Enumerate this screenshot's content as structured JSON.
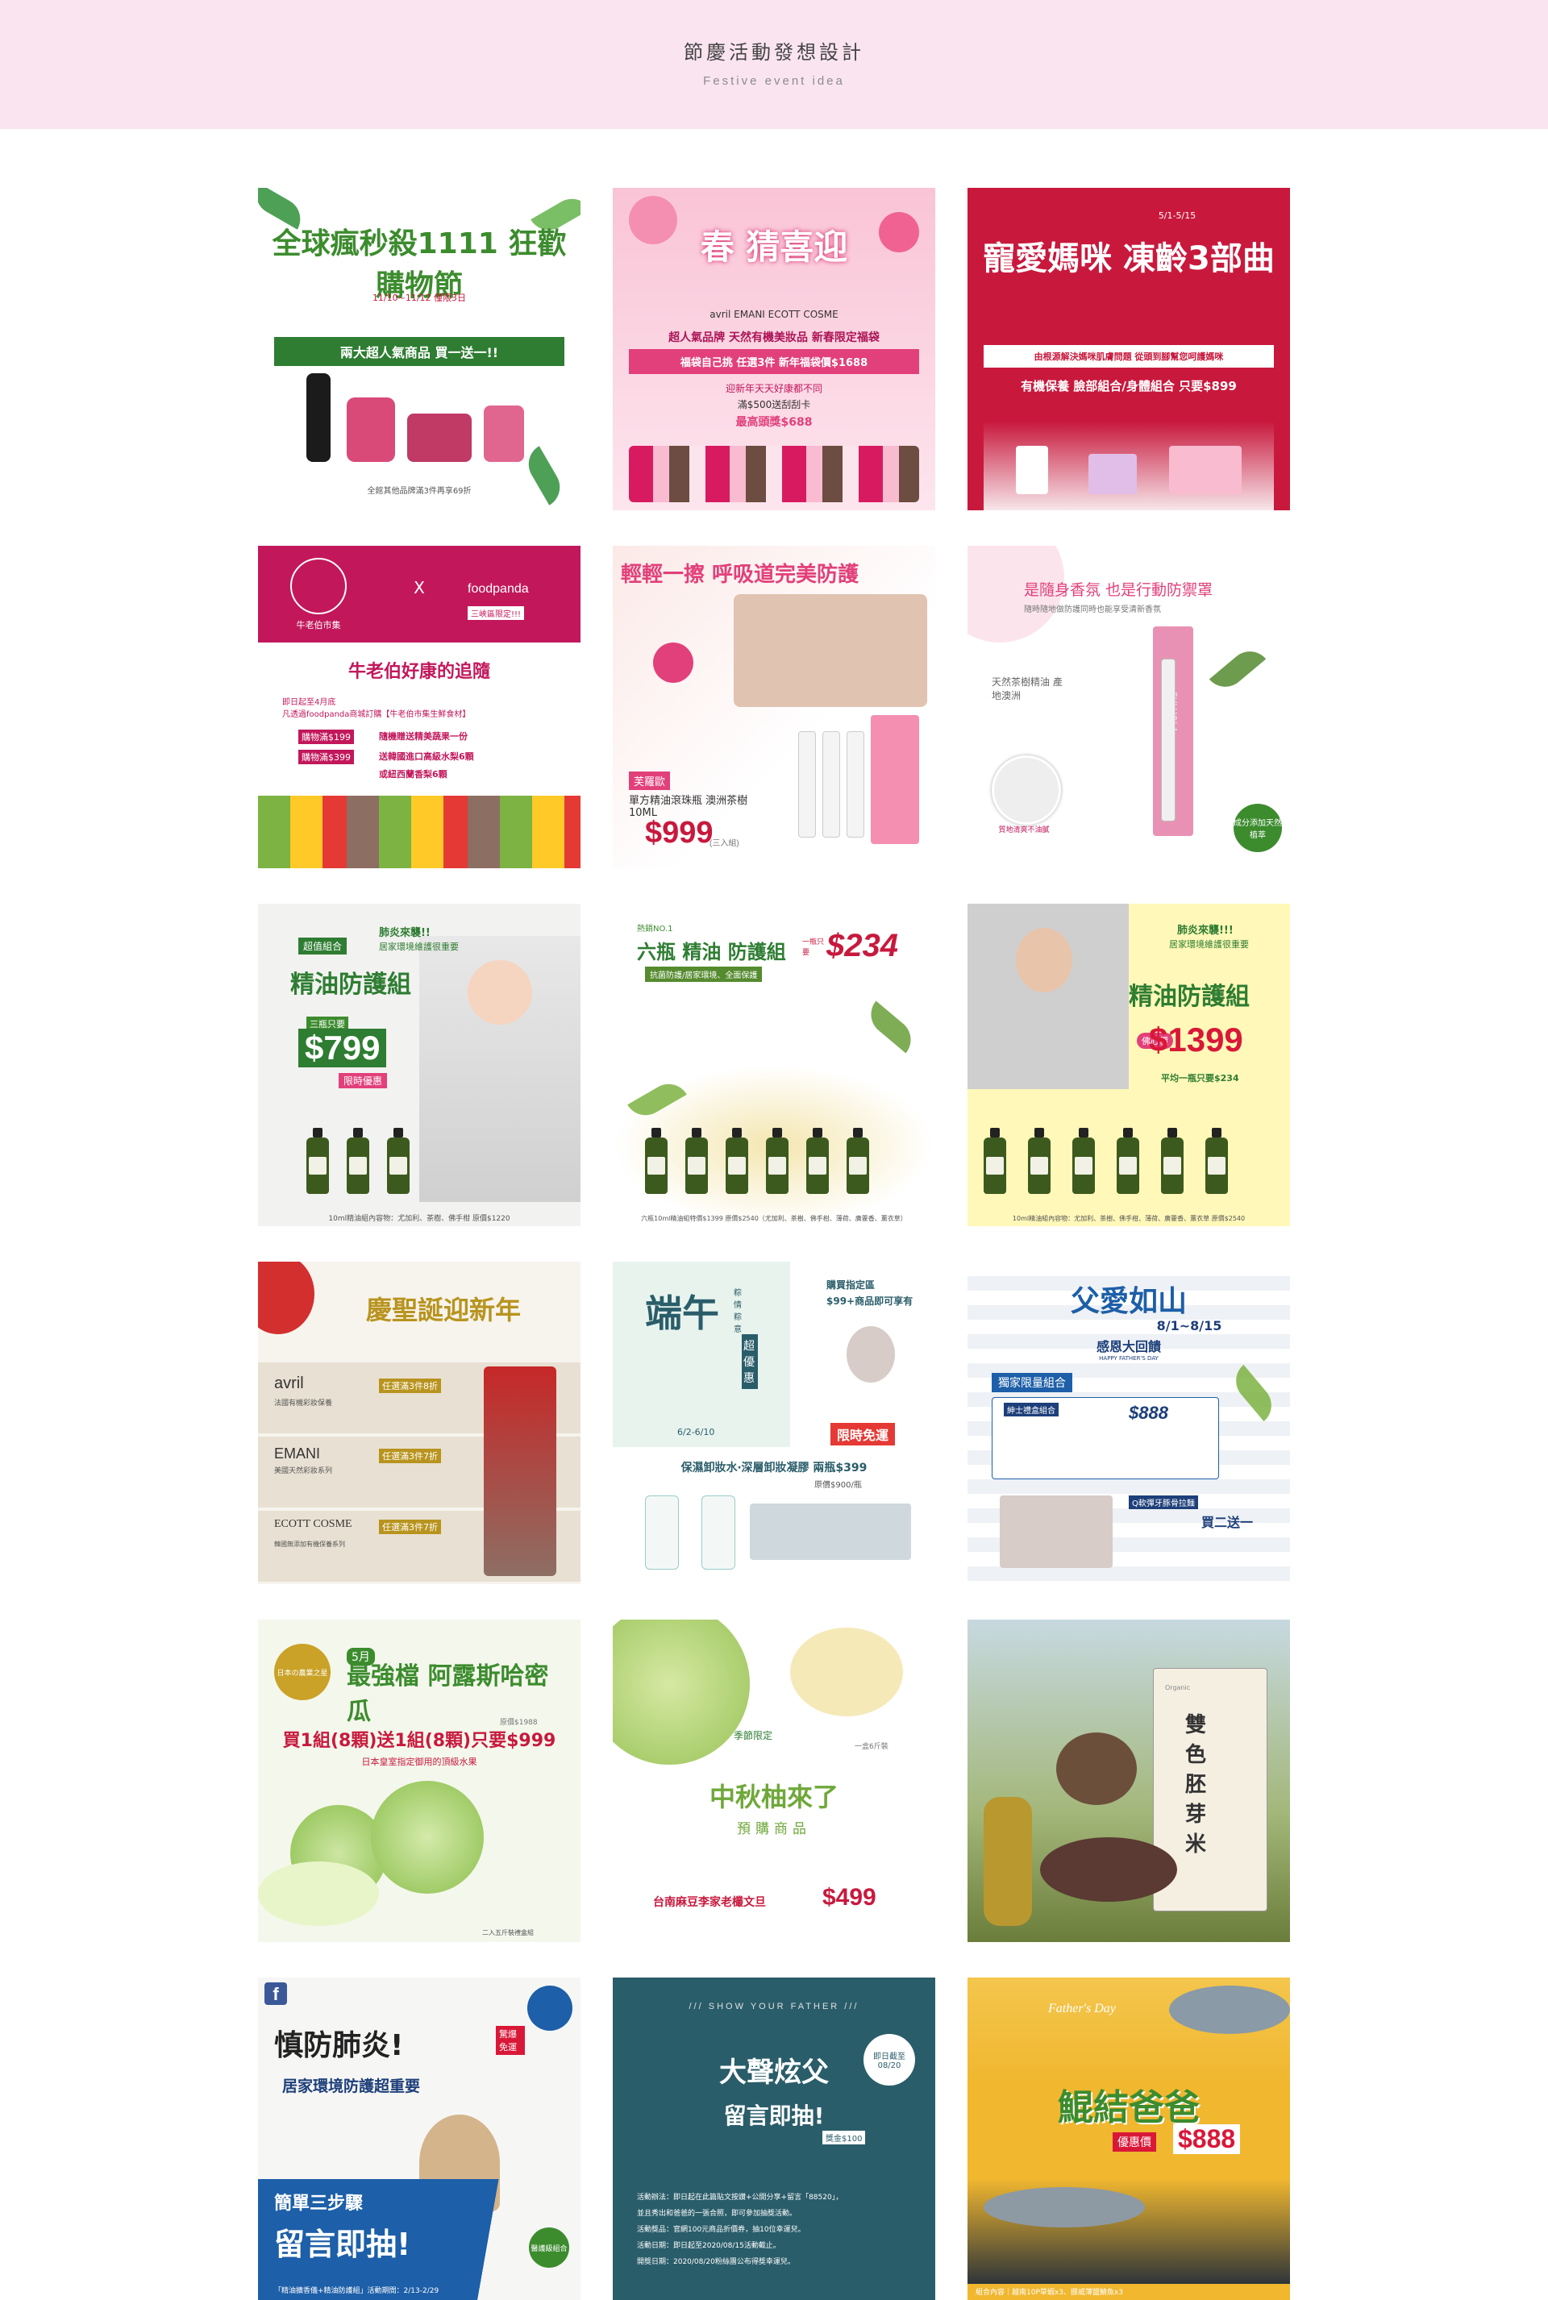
{
  "header": {
    "title": "節慶活動發想設計",
    "subtitle": "Festive event idea"
  },
  "cards": [
    {
      "headline": "全球瘋秒殺1111 狂歡購物節",
      "sub": "11/10~11/12 僅限3日",
      "banner": "兩大超人氣商品 買一送一!!",
      "note": "全館其他品牌滿3件再享69折"
    },
    {
      "headline": "春 猜喜迎",
      "brands": "avril EMANI ECOTT COSME",
      "line1": "超人氣品牌 天然有機美妝品 新春限定福袋",
      "line2": "福袋自己挑 任選3件 新年福袋價$1688",
      "line3": "迎新年天天好康都不同",
      "line4": "滿$500送刮刮卡",
      "line5": "最高頭獎$688"
    },
    {
      "headline": "寵愛媽咪 凍齡3部曲",
      "date": "5/1-5/15",
      "banner": "由根源解決媽咪肌膚問題 從頭到腳幫您呵護媽咪",
      "offer": "有機保養 臉部組合/身體組合 只要$899"
    },
    {
      "brand1": "牛老伯市集",
      "x": "X",
      "brand2": "foodpanda",
      "tag": "三峽區限定!!!",
      "headline": "牛老伯好康的追隨",
      "line1": "即日起至4月底",
      "line2": "凡透過foodpanda商城訂購【牛老伯市集生鮮食材】",
      "tier1": "購物滿$199",
      "tier1_gift": "隨機贈送精美蔬果一份",
      "tier2": "購物滿$399",
      "tier2_gift": "送韓國進口高級水梨6顆",
      "tier2_alt": "或紐西蘭香梨6顆"
    },
    {
      "headline": "輕輕一擦 呼吸道完美防護",
      "brand": "芙羅歐",
      "product": "單方精油滾珠瓶 澳洲茶樹10ML",
      "price": "$999",
      "price_note": "(三入組)"
    },
    {
      "headline": "是隨身香氛 也是行動防禦罩",
      "sub": "隨時隨地做防護同時也能享受清新香氛",
      "tea": "天然茶樹精油 產地澳洲",
      "brand": "FULUOLA",
      "badge": "成分添加天然植萃",
      "badge2": "質地清爽不油膩"
    },
    {
      "tag": "超值組合",
      "headline1": "肺炎來襲!!",
      "headline2": "居家環境維護很重要",
      "title": "精油防護組",
      "label": "三瓶只要",
      "price": "$799",
      "limit": "限時優惠",
      "foot": "10ml精油組內容物：尤加利、茶樹、佛手柑 原價$1220"
    },
    {
      "tag": "熱銷NO.1",
      "title": "六瓶 精油 防護組",
      "sub": "抗菌防護/居家環境、全面保護",
      "price": "$234",
      "price_pre": "一瓶只要",
      "foot": "六瓶10ml精油組特價$1399 原價$2540（尤加利、茶樹、佛手柑、薄荷、廣藿香、薰衣草）"
    },
    {
      "headline1": "肺炎來襲!!!",
      "headline2": "居家環境維護很重要",
      "title": "精油防護組",
      "badge": "佛心價",
      "price": "$1399",
      "avg": "平均一瓶只要$234",
      "foot": "10ml精油組內容物：尤加利、茶樹、佛手柑、薄荷、廣藿香、薰衣草 原價$2540"
    },
    {
      "headline": "慶聖誕迎新年",
      "b1": "avril",
      "b1_sub": "法國有機彩妝保養",
      "b1_offer": "任選滿3件8折",
      "b2": "EMANI",
      "b2_sub": "美國天然彩妝系列",
      "b2_offer": "任選滿3件7折",
      "b3": "ECOTT COSME",
      "b3_sub": "韓國無添加有機保養系列",
      "b3_offer": "任選滿3件7折"
    },
    {
      "headline": "端午",
      "sub": "粽情粽意",
      "tag": "超優惠",
      "dates": "6/2-6/10",
      "promo1": "購買指定區",
      "promo2": "$99+商品即可享有",
      "banner": "限時免運",
      "offer": "保濕卸妝水‧深層卸妝凝膠 兩瓶$399",
      "orig": "原價$900/瓶"
    },
    {
      "headline": "父愛如山",
      "date": "8/1~8/15",
      "sub": "感恩大回饋",
      "tiny": "HAPPY FATHER'S DAY",
      "set": "獨家限量組合",
      "gent": "紳士禮盒組合",
      "price": "$888",
      "combo": "Q軟彈牙豚骨拉麵",
      "offer": "買二送一"
    },
    {
      "medal": "日本の農業之星",
      "month": "5月",
      "headline": "最強檔 阿露斯哈密瓜",
      "offer": "買1組(8顆)送1組(8顆)只要$999",
      "sub": "日本皇室指定御用的頂級水果",
      "orig": "原價$1988",
      "foot": "二入五斤裝禮盒組"
    },
    {
      "label": "季節限定",
      "unit": "一盒6斤裝",
      "headline": "中秋柚來了",
      "sub": "預購商品",
      "store": "台南麻豆李家老欉文旦",
      "price": "$499"
    },
    {
      "title": "雙色胚芽米",
      "note": "Organic"
    },
    {
      "headline": "慎防肺炎!",
      "tag": "驚爆免運",
      "sub": "居家環境防護超重要",
      "steps": "簡單三步驟",
      "cta": "留言即抽!",
      "seal": "醫護級組合",
      "foot": "「精油擴香儀+精油防護組」活動期間：2/13-2/29"
    },
    {
      "top": "/// SHOW YOUR FATHER ///",
      "headline": "大聲炫父",
      "cta": "留言即抽!",
      "prize": "獎金$100",
      "deadline": "即日截至 08/20",
      "r1": "活動辦法：即日起在此篇貼文按讚+公開分享+留言「88520」，",
      "r2": "並且秀出和爸爸的一張合照，即可參加抽獎活動。",
      "r3": "活動獎品：官網100元商品折價券，抽10位幸運兒。",
      "r4": "活動日期：即日起至2020/08/15活動截止。",
      "r5": "開獎日期：2020/08/20粉絲團公布得獎幸運兒。"
    },
    {
      "script": "Father's Day",
      "headline": "鯤結爸爸",
      "label": "優惠價",
      "price": "$888",
      "foot": "組合內容｜越南10P草蝦x3、挪威薄鹽鯖魚x3"
    }
  ],
  "colors": {
    "header_bg": "#fae4ef",
    "green": "#3c8c2e",
    "pink": "#e2407a",
    "red": "#c8193d",
    "crimson": "#d91838",
    "navy": "#1d5fa8",
    "teal": "#2a5d6a"
  }
}
